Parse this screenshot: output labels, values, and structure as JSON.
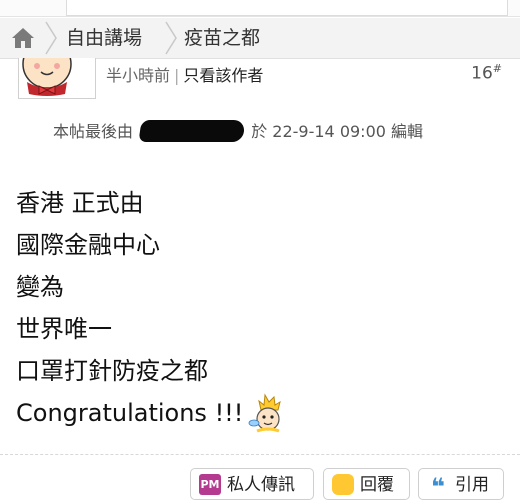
{
  "breadcrumb": {
    "items": [
      "自由講場",
      "疫苗之都"
    ]
  },
  "post": {
    "time": "半小時前",
    "author_only": "只看該作者",
    "floor_number": "16",
    "floor_mark": "#",
    "edit_prefix": "本帖最後由",
    "edit_suffix": "於 22-9-14 09:00 編輯",
    "lines": [
      "香港 正式由",
      "國際金融中心",
      "變為",
      "世界唯一",
      "口罩打針防疫之都",
      "Congratulations !!!"
    ]
  },
  "actions": {
    "pm": {
      "icon_text": "PM",
      "label": "私人傳訊"
    },
    "reply": {
      "label": "回覆"
    },
    "quote": {
      "label": "引用"
    }
  }
}
